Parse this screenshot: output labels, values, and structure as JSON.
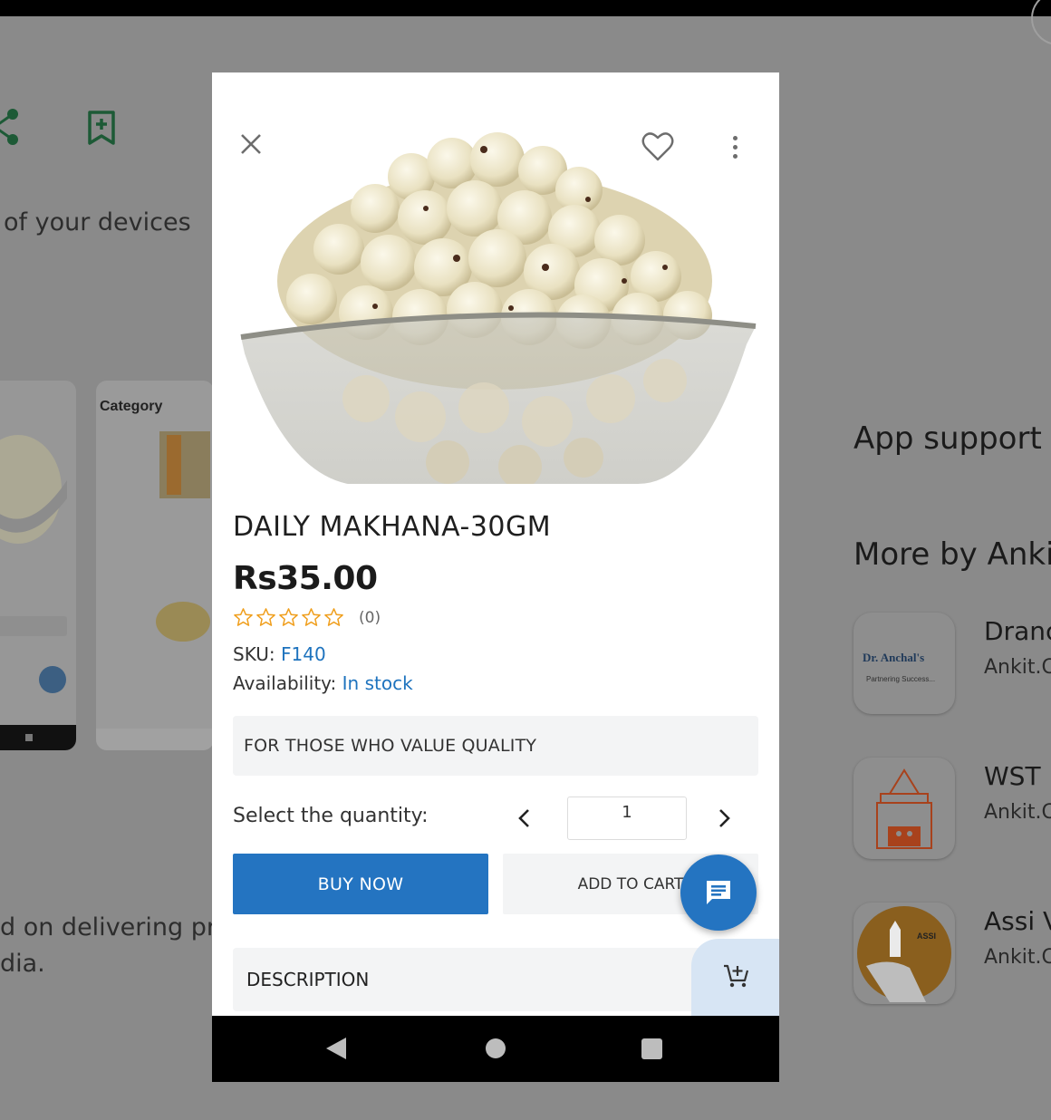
{
  "background": {
    "devices_text": "of your devices",
    "delivering_text_line1": "d on delivering pro",
    "delivering_text_line2": "dia.",
    "app_support_heading": "App support",
    "more_by_heading": "More by Anki",
    "screenshot_category_title": "Category",
    "apps": [
      {
        "name": "Dranc",
        "developer": "Ankit.C",
        "icon_text": "Dr. Anchal's",
        "icon_sub": "Partnering Success..."
      },
      {
        "name": "WST",
        "developer": "Ankit.C"
      },
      {
        "name": "Assi V",
        "developer": "Ankit.C",
        "icon_text": "ASSI"
      }
    ]
  },
  "product": {
    "name": "DAILY MAKHANA-30GM",
    "price": "Rs35.00",
    "stars": 5,
    "rating_value": 0,
    "review_count": "(0)",
    "sku_label": "SKU:",
    "sku_value": "F140",
    "availability_label": "Availability:",
    "availability_value": "In stock",
    "tagline": "FOR THOSE WHO VALUE QUALITY"
  },
  "quantity": {
    "label": "Select the quantity:",
    "value": "1"
  },
  "actions": {
    "buy_now": "BUY NOW",
    "add_to_cart": "ADD TO CART"
  },
  "description": {
    "label": "DESCRIPTION"
  },
  "colors": {
    "primary_blue": "#2474c1",
    "star_orange": "#f0a020",
    "link_blue": "#1e73be"
  },
  "icons": {
    "close": "close-icon",
    "favorite": "heart-icon",
    "more": "more-vert-icon",
    "chat": "chat-icon",
    "cart": "cart-plus-icon",
    "share": "share-icon",
    "bookmark": "bookmark-add-icon"
  }
}
